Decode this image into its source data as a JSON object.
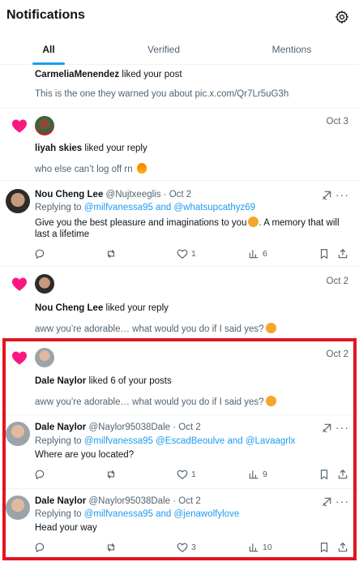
{
  "header": {
    "title": "Notifications"
  },
  "tabs": [
    {
      "label": "All",
      "active": true
    },
    {
      "label": "Verified",
      "active": false
    },
    {
      "label": "Mentions",
      "active": false
    }
  ],
  "colors": {
    "accent": "#1d9bf0",
    "heart": "#f91880",
    "highlight": "#e3151f"
  },
  "notif1": {
    "user": "CarmeliaMenendez",
    "action": " liked your post",
    "text": "This is the one they warned you about pic.x.com/Qr7Lr5uG3h"
  },
  "notif2": {
    "date": "Oct 3",
    "user": "liyah skies",
    "action": " liked your reply",
    "text": "who else can’t log off rn"
  },
  "tweet1": {
    "name": "Nou Cheng Lee",
    "handle": "@Nujtxeeglis",
    "sep": " · ",
    "date": "Oct 2",
    "replying_prefix": "Replying to ",
    "replying_to": "@milfvanessa95 and @whatsupcathyz69",
    "text_line1": "Give you the best pleasure and imaginations to you",
    "text_line1b": ". A memory that will",
    "text_line2": "last a lifetime",
    "likes": "1",
    "views": "6"
  },
  "notif3": {
    "date": "Oct 2",
    "user": "Nou Cheng Lee",
    "action": " liked your reply",
    "text": "aww you’re adorable… what would you do if I said yes?"
  },
  "notif4": {
    "date": "Oct 2",
    "user": "Dale Naylor",
    "action": " liked 6 of your posts",
    "text": "aww you’re adorable… what would you do if I said yes?"
  },
  "tweet2": {
    "name": "Dale Naylor",
    "handle": "@Naylor95038Dale",
    "sep": " · ",
    "date": "Oct 2",
    "replying_prefix": "Replying to ",
    "replying_to": "@milfvanessa95 @EscadBeoulve and @Lavaagrlx",
    "text": "Where are you located?",
    "likes": "1",
    "views": "9"
  },
  "tweet3": {
    "name": "Dale Naylor",
    "handle": "@Naylor95038Dale",
    "sep": " · ",
    "date": "Oct 2",
    "replying_prefix": "Replying to ",
    "replying_to": "@milfvanessa95 and @jenawolfylove",
    "text": "Head your way",
    "likes": "3",
    "views": "10"
  }
}
